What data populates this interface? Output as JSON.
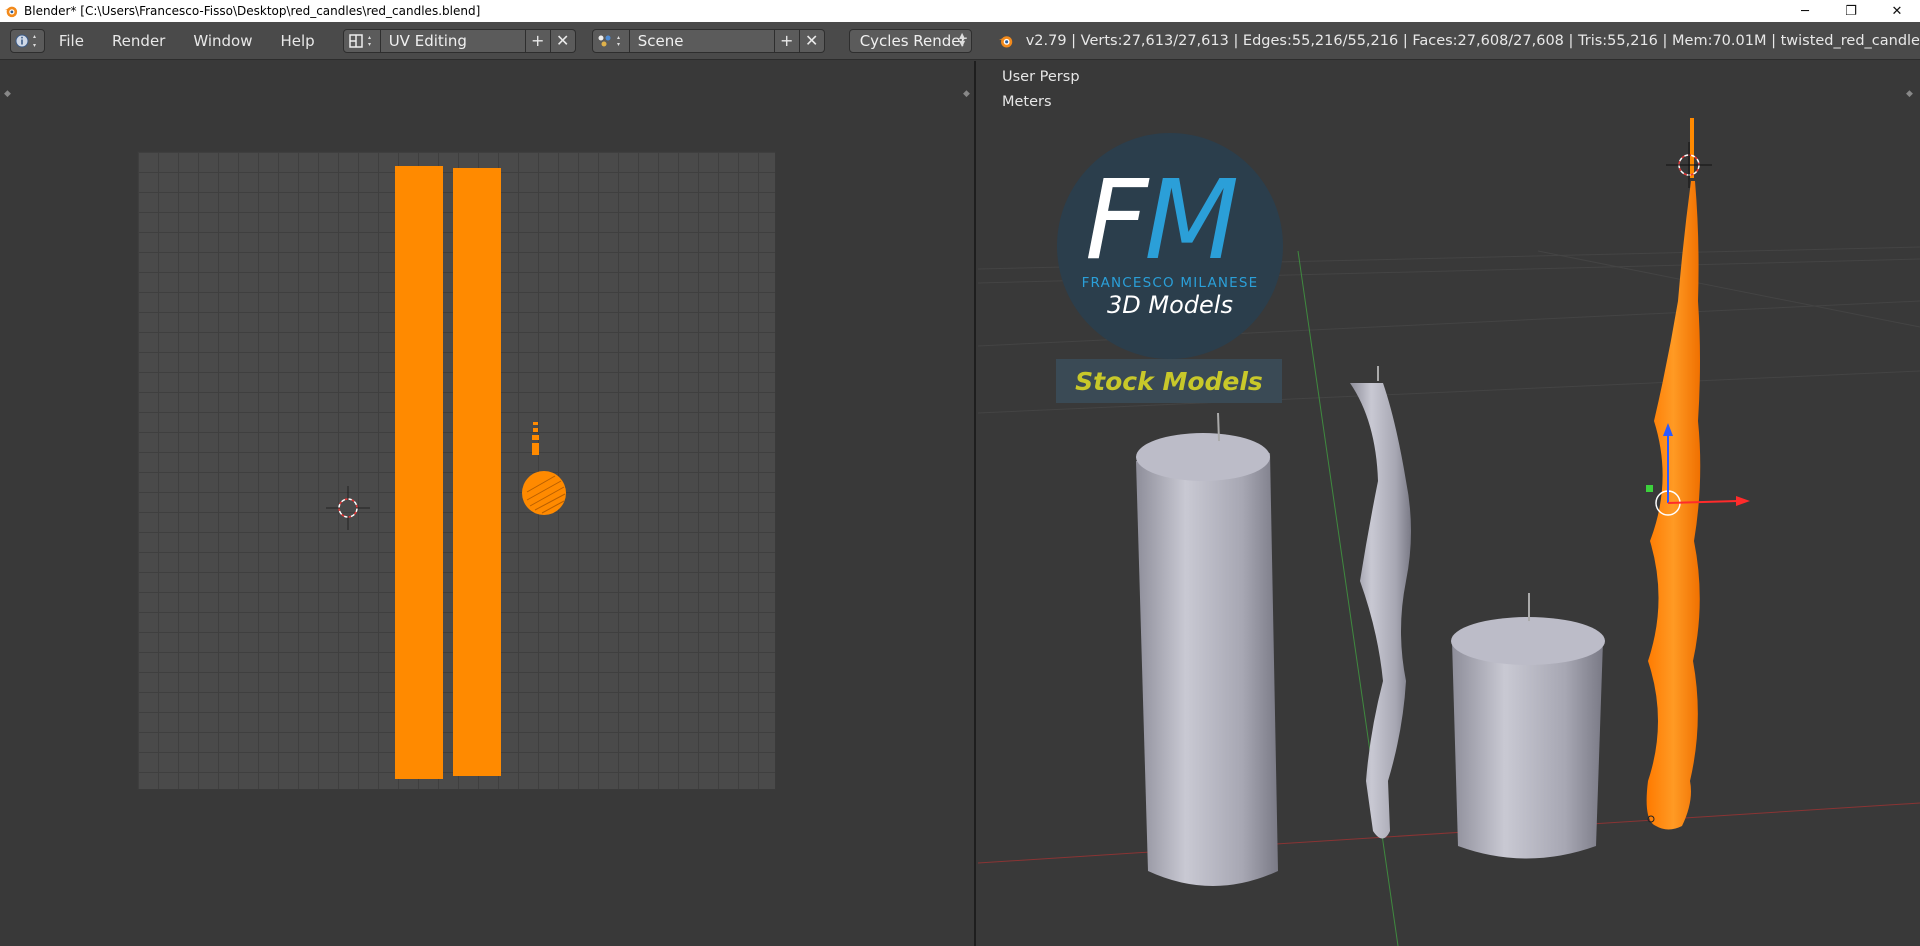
{
  "window": {
    "title": "Blender* [C:\\Users\\Francesco-Fisso\\Desktop\\red_candles\\red_candles.blend]",
    "minimize_glyph": "─",
    "restore_glyph": "❐",
    "close_glyph": "✕"
  },
  "header": {
    "menus": [
      "File",
      "Render",
      "Window",
      "Help"
    ],
    "screen_layout": "UV Editing",
    "scene": "Scene",
    "render_engine": "Cycles Render",
    "stats": "v2.79 | Verts:27,613/27,613 | Edges:55,216/55,216 | Faces:27,608/27,608 | Tris:55,216 | Mem:70.01M | twisted_red_candle",
    "add_glyph": "+",
    "close_glyph": "✕"
  },
  "viewport": {
    "view_name": "User Persp",
    "units": "Meters"
  },
  "watermark": {
    "initials_f": "F",
    "initials_m": "M",
    "name": "FRANCESCO MILANESE",
    "subtitle": "3D Models",
    "badge": "Stock Models"
  },
  "colors": {
    "accent_selection": "#ff8a00",
    "editor_bg": "#393939",
    "header_bg": "#4a4a4a",
    "candle_grey": "#b4b4c0"
  }
}
